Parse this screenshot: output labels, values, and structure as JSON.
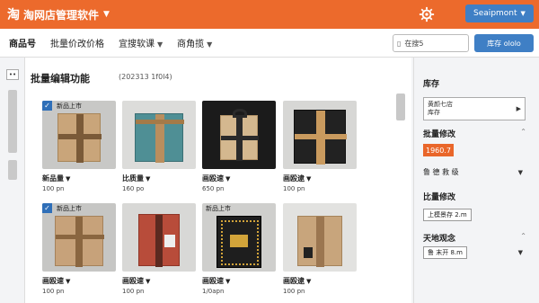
{
  "app": {
    "logo": "淘",
    "title": "淘网店管理软件",
    "account_label": "Seaipmont"
  },
  "tabs": [
    {
      "label": "商品号"
    },
    {
      "label": "批量价改价格"
    },
    {
      "label": "宜搜软课"
    },
    {
      "label": "商角揽"
    }
  ],
  "search": {
    "icon_text": "▯",
    "value": "在搜5"
  },
  "stock_button": "库存 ololo",
  "main": {
    "title": "批量编辑功能",
    "date": "(202313 1f0l4)"
  },
  "products": [
    {
      "tag": "新品上市",
      "checked": true,
      "name": "新品量",
      "qty": "100 pn"
    },
    {
      "tag": "",
      "checked": true,
      "name": "比质量",
      "qty": "160 po"
    },
    {
      "tag": "",
      "checked": true,
      "name": "画殴速",
      "qty": "650 pn"
    },
    {
      "tag": "",
      "checked": false,
      "name": "画殴逮",
      "qty": "100 pn"
    },
    {
      "tag": "新品上市",
      "checked": true,
      "name": "画殴速",
      "qty": "100 pn"
    },
    {
      "tag": "",
      "checked": true,
      "name": "画殴速",
      "qty": "100 pn"
    },
    {
      "tag": "新品上市",
      "checked": true,
      "name": "画殴速",
      "qty": "1/0apn"
    },
    {
      "tag": "",
      "checked": true,
      "name": "画殴逮",
      "qty": "100 pn"
    }
  ],
  "side": {
    "stock_title": "库存",
    "stock_select": "黄颜七店\n库存",
    "batch_title": "批量修改",
    "orange_value": "1960.7",
    "row1": "鲁 德 救 级",
    "batch2_title": "比量修改",
    "pill1": "上模景存 2.m",
    "transfer_title": "天地观念",
    "pill2": "鲁 末开 8.m"
  },
  "colors": {
    "accent": "#ec6a2c",
    "primary": "#3f7fc5"
  }
}
